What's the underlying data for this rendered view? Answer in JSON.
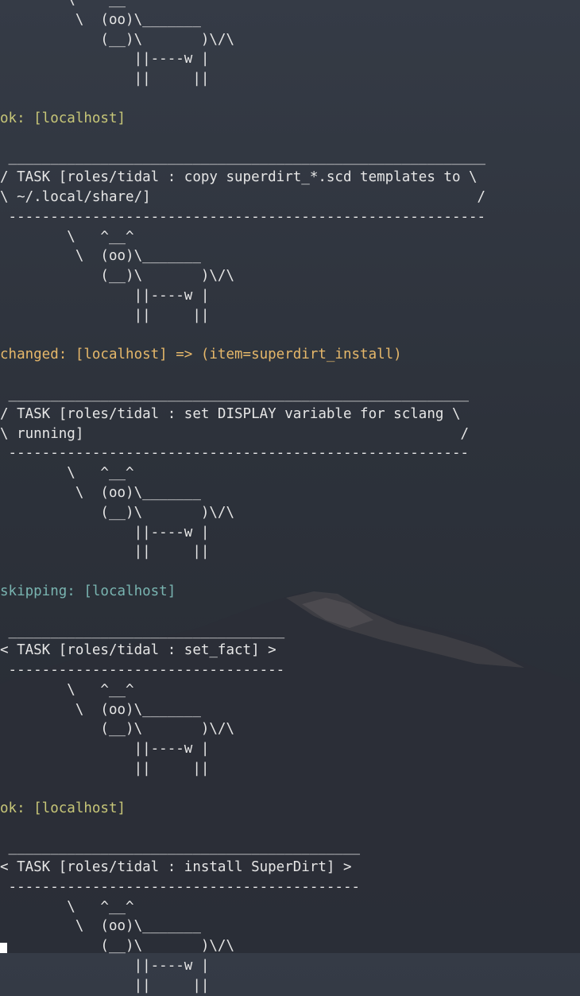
{
  "terminal": {
    "lines": [
      {
        "text": "        \\   ^__^",
        "kind": "cow"
      },
      {
        "text": "         \\  (oo)\\_______",
        "kind": "cow"
      },
      {
        "text": "            (__)\\       )\\/\\",
        "kind": "cow"
      },
      {
        "text": "                ||----w |",
        "kind": "cow"
      },
      {
        "text": "                ||     ||",
        "kind": "cow"
      },
      {
        "text": "",
        "kind": "blank"
      },
      {
        "text": "ok: [localhost]",
        "kind": "status-ok"
      },
      {
        "text": "",
        "kind": "blank"
      },
      {
        "text": " _________________________________________________________",
        "kind": "banner"
      },
      {
        "text": "/ TASK [roles/tidal : copy superdirt_*.scd templates to \\",
        "kind": "banner"
      },
      {
        "text": "\\ ~/.local/share/]                                       /",
        "kind": "banner"
      },
      {
        "text": " ---------------------------------------------------------",
        "kind": "banner"
      },
      {
        "text": "        \\   ^__^",
        "kind": "cow"
      },
      {
        "text": "         \\  (oo)\\_______",
        "kind": "cow"
      },
      {
        "text": "            (__)\\       )\\/\\",
        "kind": "cow"
      },
      {
        "text": "                ||----w |",
        "kind": "cow"
      },
      {
        "text": "                ||     ||",
        "kind": "cow"
      },
      {
        "text": "",
        "kind": "blank"
      },
      {
        "text": "changed: [localhost] => (item=superdirt_install)",
        "kind": "status-changed"
      },
      {
        "text": "",
        "kind": "blank"
      },
      {
        "text": " _______________________________________________________",
        "kind": "banner"
      },
      {
        "text": "/ TASK [roles/tidal : set DISPLAY variable for sclang \\",
        "kind": "banner"
      },
      {
        "text": "\\ running]                                             /",
        "kind": "banner"
      },
      {
        "text": " -------------------------------------------------------",
        "kind": "banner"
      },
      {
        "text": "        \\   ^__^",
        "kind": "cow"
      },
      {
        "text": "         \\  (oo)\\_______",
        "kind": "cow"
      },
      {
        "text": "            (__)\\       )\\/\\",
        "kind": "cow"
      },
      {
        "text": "                ||----w |",
        "kind": "cow"
      },
      {
        "text": "                ||     ||",
        "kind": "cow"
      },
      {
        "text": "",
        "kind": "blank"
      },
      {
        "text": "skipping: [localhost]",
        "kind": "status-skipping"
      },
      {
        "text": "",
        "kind": "blank"
      },
      {
        "text": " _________________________________",
        "kind": "banner"
      },
      {
        "text": "< TASK [roles/tidal : set_fact] >",
        "kind": "banner"
      },
      {
        "text": " ---------------------------------",
        "kind": "banner"
      },
      {
        "text": "        \\   ^__^",
        "kind": "cow"
      },
      {
        "text": "         \\  (oo)\\_______",
        "kind": "cow"
      },
      {
        "text": "            (__)\\       )\\/\\",
        "kind": "cow"
      },
      {
        "text": "                ||----w |",
        "kind": "cow"
      },
      {
        "text": "                ||     ||",
        "kind": "cow"
      },
      {
        "text": "",
        "kind": "blank"
      },
      {
        "text": "ok: [localhost]",
        "kind": "status-ok"
      },
      {
        "text": "",
        "kind": "blank"
      },
      {
        "text": " __________________________________________",
        "kind": "banner"
      },
      {
        "text": "< TASK [roles/tidal : install SuperDirt] >",
        "kind": "banner"
      },
      {
        "text": " ------------------------------------------",
        "kind": "banner"
      },
      {
        "text": "        \\   ^__^",
        "kind": "cow"
      },
      {
        "text": "         \\  (oo)\\_______",
        "kind": "cow"
      },
      {
        "text": "            (__)\\       )\\/\\",
        "kind": "cow"
      },
      {
        "text": "                ||----w |",
        "kind": "cow"
      },
      {
        "text": "                ||     ||",
        "kind": "cow"
      }
    ]
  },
  "colors": {
    "text": "#e6e6e6",
    "ok": "#c8c778",
    "changed": "#e6b86a",
    "skipping": "#79b4b0",
    "background": "#2d323b"
  }
}
